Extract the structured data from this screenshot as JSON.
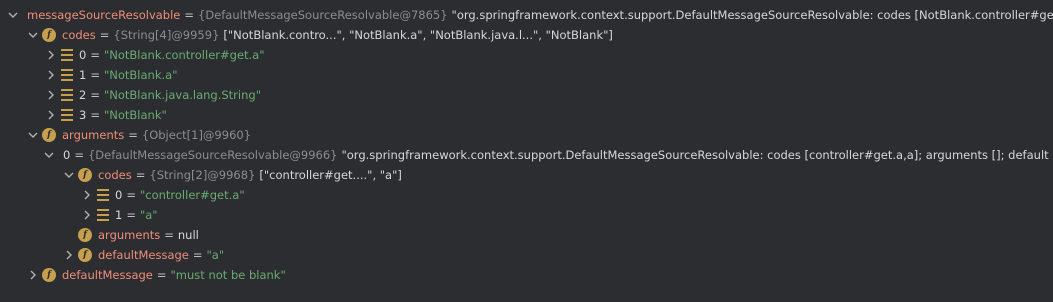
{
  "rows": [
    {
      "name": "messageSourceResolvable",
      "type": "{DefaultMessageSourceResolvable@7865}",
      "value": "\"org.springframework.context.support.DefaultMessageSourceResolvable: codes [NotBlank.controller#get.a,NotBlank.a,NotBlank.java.lang.String,NotBlank]; arguments [org.springframework.context.support.DefaultMessageSourceResolvable: codes [controller#get.a,a]; arguments []; default message [a]]; default message [must not be blank]\""
    },
    {
      "name": "codes",
      "type": "{String[4]@9959}",
      "value": "[\"NotBlank.contro...\", \"NotBlank.a\", \"NotBlank.java.l...\", \"NotBlank\"]"
    },
    {
      "name": "0",
      "str": "\"NotBlank.controller#get.a\""
    },
    {
      "name": "1",
      "str": "\"NotBlank.a\""
    },
    {
      "name": "2",
      "str": "\"NotBlank.java.lang.String\""
    },
    {
      "name": "3",
      "str": "\"NotBlank\""
    },
    {
      "name": "arguments",
      "type": "{Object[1]@9960}",
      "value": ""
    },
    {
      "name": "0",
      "type": "{DefaultMessageSourceResolvable@9966}",
      "value": "\"org.springframework.context.support.DefaultMessageSourceResolvable: codes [controller#get.a,a]; arguments []; default message [a]\""
    },
    {
      "name": "codes",
      "type": "{String[2]@9968}",
      "value": "[\"controller#get....\", \"a\"]"
    },
    {
      "name": "0",
      "str": "\"controller#get.a\""
    },
    {
      "name": "1",
      "str": "\"a\""
    },
    {
      "name": "arguments",
      "value": "null"
    },
    {
      "name": "defaultMessage",
      "str": "\"a\""
    },
    {
      "name": "defaultMessage",
      "str": "\"must not be blank\""
    }
  ],
  "eq": "="
}
